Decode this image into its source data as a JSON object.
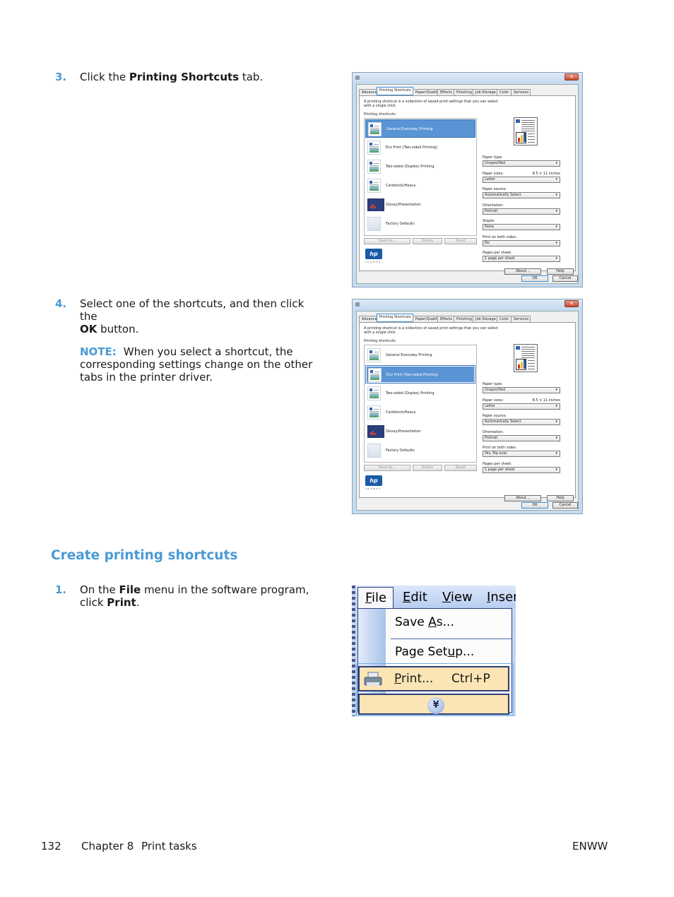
{
  "steps": {
    "step3": {
      "number": "3.",
      "text_before": "Click the ",
      "bold": "Printing Shortcuts",
      "text_after": " tab."
    },
    "step4": {
      "number": "4.",
      "line1": "Select one of the shortcuts, and then click the",
      "bold": "OK",
      "text_after": " button.",
      "note_label": "NOTE:",
      "note_text": "When you select a shortcut, the corresponding settings change on the other tabs in the printer driver."
    },
    "section_heading": "Create printing shortcuts",
    "step1": {
      "number": "1.",
      "text_before": "On the ",
      "bold1": "File",
      "text_mid": " menu in the software program, click ",
      "bold2": "Print",
      "text_after": "."
    }
  },
  "dialog1": {
    "tabs": [
      "Advanced",
      "Printing Shortcuts",
      "Paper/Quality",
      "Effects",
      "Finishing",
      "Job Storage",
      "Color",
      "Services"
    ],
    "active_tab": "Printing Shortcuts",
    "description": "A printing shortcut is a collection of saved print settings that you can select with a single click.",
    "shortcuts_label": "Printing shortcuts:",
    "shortcuts": [
      "General Everyday Printing",
      "Eco Print (Two-sided Printing)",
      "Two-sided (Duplex) Printing",
      "Cardstock/Heavy",
      "Glossy/Presentation",
      "Factory Defaults"
    ],
    "selected_shortcut": "General Everyday Printing",
    "fields": {
      "paper_type_label": "Paper type:",
      "paper_type": "Unspecified",
      "paper_sizes_label": "Paper sizes:",
      "paper_size_extra": "8.5 × 11 inches",
      "paper_size": "Letter",
      "paper_source_label": "Paper source:",
      "paper_source": "Automatically Select",
      "orientation_label": "Orientation:",
      "orientation": "Portrait",
      "staple_label": "Staple:",
      "staple": "None",
      "both_sides_label": "Print on both sides:",
      "both_sides": "No",
      "pps_label": "Pages per sheet:",
      "pps": "1 page per sheet"
    },
    "buttons": {
      "save_as": "Save As...",
      "delete": "Delete",
      "reset": "Reset",
      "about": "About...",
      "help": "Help",
      "ok": "OK",
      "cancel": "Cancel"
    },
    "logo_text": "hp",
    "logo_tagline": "invent"
  },
  "dialog2": {
    "tabs": [
      "Advanced",
      "Printing Shortcuts",
      "Paper/Quality",
      "Effects",
      "Finishing",
      "Job Storage",
      "Color",
      "Services"
    ],
    "active_tab": "Printing Shortcuts",
    "description": "A printing shortcut is a collection of saved print settings that you can select with a single click.",
    "shortcuts_label": "Printing shortcuts:",
    "shortcuts": [
      "General Everyday Printing",
      "Eco Print (Two-sided Printing)",
      "Two-sided (Duplex) Printing",
      "Cardstock/Heavy",
      "Glossy/Presentation",
      "Factory Defaults"
    ],
    "selected_shortcut": "Eco Print (Two-sided Printing)",
    "fields": {
      "paper_type_label": "Paper type:",
      "paper_type": "Unspecified",
      "paper_sizes_label": "Paper sizes:",
      "paper_size_extra": "8.5 × 11 inches",
      "paper_size": "Letter",
      "paper_source_label": "Paper source:",
      "paper_source": "Automatically Select",
      "orientation_label": "Orientation:",
      "orientation": "Portrait",
      "both_sides_label": "Print on both sides:",
      "both_sides": "Yes, flip over",
      "pps_label": "Pages per sheet:",
      "pps": "1 page per sheet"
    },
    "buttons": {
      "save_as": "Save As...",
      "delete": "Delete",
      "reset": "Reset",
      "about": "About...",
      "help": "Help",
      "ok": "OK",
      "cancel": "Cancel"
    },
    "logo_text": "hp",
    "logo_tagline": "invent"
  },
  "file_menu": {
    "menubar": [
      "File",
      "Edit",
      "View",
      "Inser"
    ],
    "items": [
      {
        "label": "Save As...",
        "underline": "A"
      },
      {
        "label": "Page Setup...",
        "underline": "u"
      },
      {
        "label": "Print...",
        "shortcut": "Ctrl+P",
        "underline": "P",
        "highlighted": true
      }
    ],
    "expand_icon": "chevron-double-down-icon"
  },
  "footer": {
    "page_number": "132",
    "chapter": "Chapter 8",
    "chapter_title": "Print tasks",
    "right": "ENWW"
  },
  "colors": {
    "accent": "#4a9ad4",
    "selection": "#5a94d4",
    "menu_highlight": "#fbe5b4"
  }
}
